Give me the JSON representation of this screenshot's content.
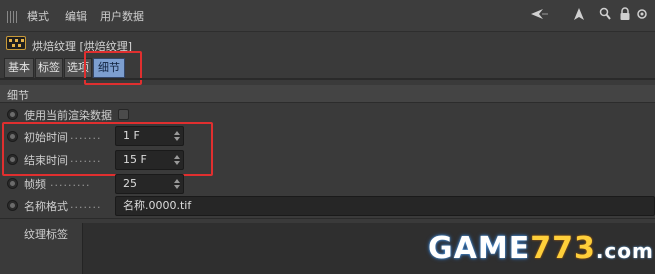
{
  "menu": {
    "items": [
      "模式",
      "编辑",
      "用户数据"
    ]
  },
  "toolbar": {
    "icons": [
      "arrow-left-icon",
      "arrow-up-icon",
      "search-icon",
      "lock-icon",
      "settings-icon",
      "expand-icon"
    ],
    "glyphs": [
      "◀",
      "▲",
      "🔍",
      "🔒",
      "⚙",
      "⤢"
    ]
  },
  "object": {
    "title": "烘焙纹理 [烘焙纹理]"
  },
  "tabs": [
    {
      "label": "基本"
    },
    {
      "label": "标签"
    },
    {
      "label": "选项"
    },
    {
      "label": "细节",
      "active": true
    }
  ],
  "section": {
    "title": "细节"
  },
  "rows": {
    "use_current": {
      "label": "使用当前渲染数据"
    },
    "start_time": {
      "label": "初始时间",
      "value": "1 F"
    },
    "end_time": {
      "label": "结束时间",
      "value": "15 F"
    },
    "fps": {
      "label": "帧频",
      "value": "25"
    },
    "name_format": {
      "label": "名称格式",
      "value": "名称.0000.tif"
    }
  },
  "bottom": {
    "label": "纹理标签"
  },
  "watermark": {
    "main": "GAME",
    "number": "773",
    "domain": ".com"
  },
  "colors": {
    "highlight": "#e02f2f",
    "tab_active": "#7d9fd0"
  }
}
